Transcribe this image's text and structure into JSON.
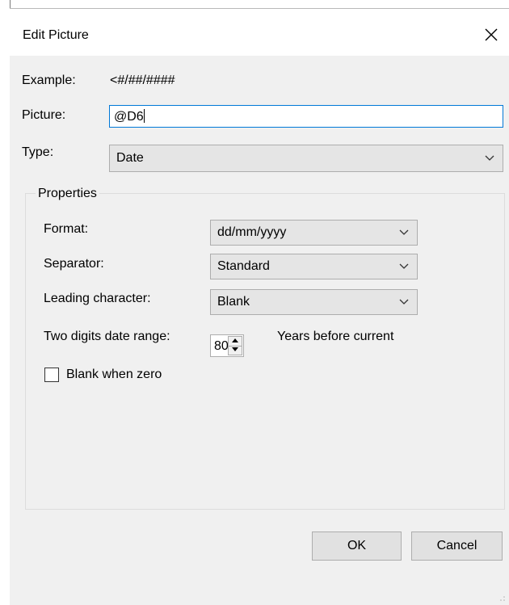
{
  "dialog": {
    "title": "Edit Picture",
    "close_icon": "close-icon"
  },
  "example": {
    "label": "Example:",
    "value": "<#/##/####"
  },
  "picture": {
    "label": "Picture:",
    "value": "@D6"
  },
  "type": {
    "label": "Type:",
    "selected": "Date"
  },
  "properties": {
    "group_title": "Properties",
    "format": {
      "label": "Format:",
      "selected": "dd/mm/yyyy"
    },
    "separator": {
      "label": "Separator:",
      "selected": "Standard"
    },
    "leading_character": {
      "label": "Leading character:",
      "selected": "Blank"
    },
    "date_range": {
      "label": "Two digits date range:",
      "value": "80",
      "suffix": "Years before current"
    },
    "blank_when_zero": {
      "label": "Blank when zero",
      "checked": false
    }
  },
  "buttons": {
    "ok": "OK",
    "cancel": "Cancel"
  },
  "colors": {
    "focus_border": "#0078d7",
    "dialog_bg": "#f0f0f0"
  }
}
